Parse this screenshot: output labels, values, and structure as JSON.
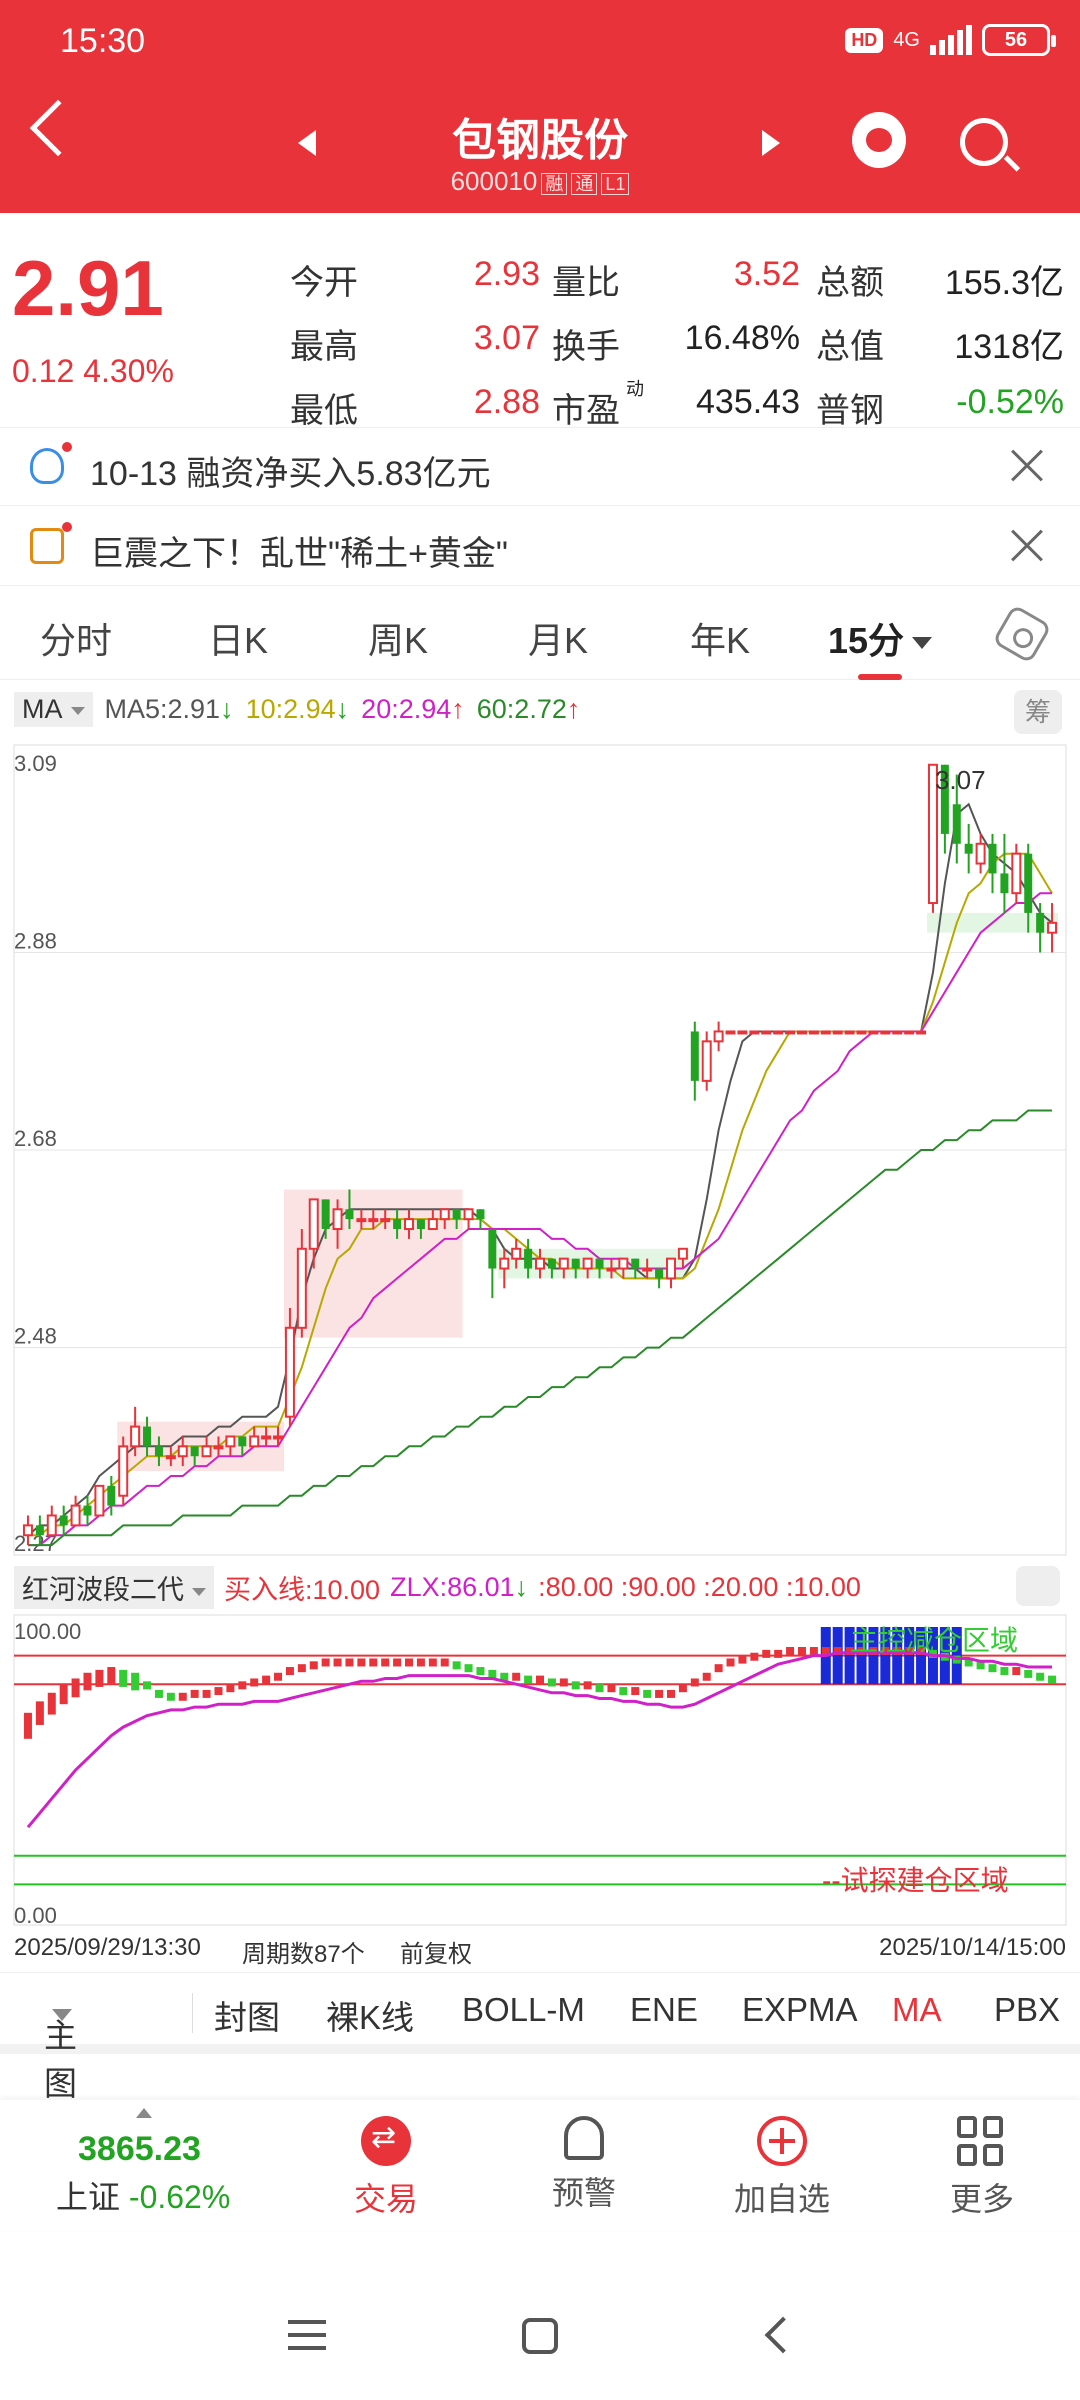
{
  "status_bar": {
    "time": "15:30",
    "hd": "HD",
    "network": "4G",
    "battery": "56"
  },
  "header": {
    "title": "包钢股份",
    "code": "600010",
    "tags": [
      "融",
      "通",
      "L1"
    ]
  },
  "quote": {
    "price": "2.91",
    "change": "0.12",
    "change_pct": "4.30%",
    "fields": [
      {
        "label": "今开",
        "value": "2.93",
        "color": "red"
      },
      {
        "label": "量比",
        "value": "3.52",
        "color": "red"
      },
      {
        "label": "总额",
        "value": "155.3亿",
        "color": "blk"
      },
      {
        "label": "最高",
        "value": "3.07",
        "color": "red"
      },
      {
        "label": "换手",
        "value": "16.48%",
        "color": "blk"
      },
      {
        "label": "总值",
        "value": "1318亿",
        "color": "blk"
      },
      {
        "label": "最低",
        "value": "2.88",
        "color": "red"
      },
      {
        "label": "市盈",
        "value": "435.43",
        "color": "blk",
        "sup": "动"
      },
      {
        "label": "普钢",
        "value": "-0.52%",
        "color": "green"
      }
    ]
  },
  "news": [
    {
      "icon": "bulb-icon",
      "text": "10-13 融资净买入5.83亿元"
    },
    {
      "icon": "document-icon",
      "text": "巨震之下！乱世\"稀土+黄金\""
    }
  ],
  "period_tabs": [
    "分时",
    "日K",
    "周K",
    "月K",
    "年K",
    "15分"
  ],
  "active_period": "15分",
  "ma_legend": {
    "selector": "MA",
    "ma5": "MA5:2.91",
    "ma10": "10:2.94",
    "ma20": "20:2.94",
    "ma60": "60:2.72",
    "chou": "筹"
  },
  "colors": {
    "accent": "#e8333a",
    "up": "#e8333a",
    "down": "#22a322",
    "ma5": "#555555",
    "ma10": "#b8a800",
    "ma20": "#d020c8",
    "ma60": "#2a8a2a"
  },
  "chart_data": [
    {
      "type": "candlestick",
      "title": "",
      "y_ticks": [
        "3.09",
        "2.88",
        "2.68",
        "2.48",
        "2.27"
      ],
      "ylim": [
        2.27,
        3.09
      ],
      "high_label": "3.07",
      "series": [
        {
          "name": "MA5",
          "values": [
            2.29,
            2.3,
            2.3,
            2.31,
            2.32,
            2.33,
            2.35,
            2.36,
            2.37,
            2.38,
            2.38,
            2.38,
            2.38,
            2.39,
            2.39,
            2.39,
            2.4,
            2.4,
            2.41,
            2.41,
            2.41,
            2.42,
            2.47,
            2.53,
            2.57,
            2.6,
            2.61,
            2.62,
            2.62,
            2.62,
            2.62,
            2.62,
            2.62,
            2.62,
            2.62,
            2.62,
            2.62,
            2.62,
            2.61,
            2.6,
            2.58,
            2.57,
            2.57,
            2.57,
            2.56,
            2.56,
            2.56,
            2.56,
            2.56,
            2.56,
            2.56,
            2.56,
            2.55,
            2.55,
            2.55,
            2.55,
            2.57,
            2.63,
            2.7,
            2.75,
            2.79,
            2.8,
            2.8,
            2.8,
            2.8,
            2.8,
            2.8,
            2.8,
            2.8,
            2.8,
            2.8,
            2.8,
            2.8,
            2.8,
            2.8,
            2.8,
            2.86,
            2.95,
            3.02,
            3.03,
            3.0,
            2.98,
            2.97,
            2.96,
            2.94,
            2.92,
            2.91
          ]
        },
        {
          "name": "MA10",
          "values": [
            2.29,
            2.29,
            2.3,
            2.3,
            2.31,
            2.32,
            2.33,
            2.34,
            2.35,
            2.36,
            2.37,
            2.37,
            2.37,
            2.38,
            2.38,
            2.38,
            2.38,
            2.39,
            2.39,
            2.4,
            2.4,
            2.4,
            2.43,
            2.46,
            2.5,
            2.54,
            2.57,
            2.58,
            2.6,
            2.6,
            2.61,
            2.61,
            2.61,
            2.61,
            2.61,
            2.61,
            2.61,
            2.61,
            2.61,
            2.6,
            2.6,
            2.59,
            2.58,
            2.57,
            2.57,
            2.56,
            2.56,
            2.56,
            2.56,
            2.56,
            2.55,
            2.55,
            2.55,
            2.55,
            2.55,
            2.55,
            2.56,
            2.59,
            2.62,
            2.66,
            2.7,
            2.73,
            2.76,
            2.78,
            2.8,
            2.8,
            2.8,
            2.8,
            2.8,
            2.8,
            2.8,
            2.8,
            2.8,
            2.8,
            2.8,
            2.8,
            2.83,
            2.87,
            2.91,
            2.94,
            2.95,
            2.97,
            2.98,
            2.98,
            2.98,
            2.96,
            2.94
          ]
        },
        {
          "name": "MA20",
          "values": [
            2.28,
            2.28,
            2.29,
            2.29,
            2.3,
            2.3,
            2.31,
            2.32,
            2.32,
            2.33,
            2.34,
            2.34,
            2.35,
            2.35,
            2.36,
            2.36,
            2.37,
            2.37,
            2.37,
            2.38,
            2.38,
            2.38,
            2.4,
            2.42,
            2.44,
            2.46,
            2.48,
            2.5,
            2.51,
            2.53,
            2.54,
            2.55,
            2.56,
            2.57,
            2.58,
            2.59,
            2.59,
            2.6,
            2.6,
            2.6,
            2.6,
            2.6,
            2.6,
            2.6,
            2.59,
            2.59,
            2.58,
            2.58,
            2.57,
            2.57,
            2.57,
            2.56,
            2.56,
            2.56,
            2.56,
            2.56,
            2.57,
            2.58,
            2.59,
            2.61,
            2.63,
            2.65,
            2.67,
            2.69,
            2.71,
            2.72,
            2.74,
            2.75,
            2.76,
            2.78,
            2.79,
            2.8,
            2.8,
            2.8,
            2.8,
            2.8,
            2.82,
            2.84,
            2.86,
            2.88,
            2.9,
            2.91,
            2.92,
            2.93,
            2.93,
            2.94,
            2.94
          ]
        },
        {
          "name": "MA60",
          "values": [
            2.28,
            2.28,
            2.28,
            2.29,
            2.29,
            2.29,
            2.29,
            2.29,
            2.3,
            2.3,
            2.3,
            2.3,
            2.3,
            2.31,
            2.31,
            2.31,
            2.31,
            2.31,
            2.32,
            2.32,
            2.32,
            2.32,
            2.33,
            2.33,
            2.34,
            2.34,
            2.35,
            2.35,
            2.36,
            2.36,
            2.37,
            2.37,
            2.38,
            2.38,
            2.39,
            2.39,
            2.4,
            2.4,
            2.41,
            2.41,
            2.42,
            2.42,
            2.43,
            2.43,
            2.44,
            2.44,
            2.45,
            2.45,
            2.46,
            2.46,
            2.47,
            2.47,
            2.48,
            2.48,
            2.49,
            2.49,
            2.5,
            2.51,
            2.52,
            2.53,
            2.54,
            2.55,
            2.56,
            2.57,
            2.58,
            2.59,
            2.6,
            2.61,
            2.62,
            2.63,
            2.64,
            2.65,
            2.66,
            2.66,
            2.67,
            2.68,
            2.68,
            2.69,
            2.69,
            2.7,
            2.7,
            2.71,
            2.71,
            2.71,
            2.72,
            2.72,
            2.72
          ]
        }
      ],
      "candles": [
        [
          2.29,
          2.3,
          2.28,
          2.31
        ],
        [
          2.3,
          2.29,
          2.28,
          2.31
        ],
        [
          2.29,
          2.31,
          2.29,
          2.32
        ],
        [
          2.31,
          2.3,
          2.29,
          2.32
        ],
        [
          2.3,
          2.32,
          2.3,
          2.33
        ],
        [
          2.32,
          2.31,
          2.3,
          2.33
        ],
        [
          2.31,
          2.34,
          2.31,
          2.34
        ],
        [
          2.34,
          2.32,
          2.31,
          2.35
        ],
        [
          2.33,
          2.38,
          2.32,
          2.39
        ],
        [
          2.38,
          2.4,
          2.37,
          2.42
        ],
        [
          2.4,
          2.38,
          2.37,
          2.41
        ],
        [
          2.38,
          2.37,
          2.36,
          2.39
        ],
        [
          2.37,
          2.37,
          2.36,
          2.38
        ],
        [
          2.37,
          2.38,
          2.36,
          2.39
        ],
        [
          2.38,
          2.37,
          2.36,
          2.38
        ],
        [
          2.37,
          2.38,
          2.37,
          2.39
        ],
        [
          2.38,
          2.38,
          2.37,
          2.39
        ],
        [
          2.38,
          2.39,
          2.37,
          2.39
        ],
        [
          2.39,
          2.38,
          2.37,
          2.39
        ],
        [
          2.38,
          2.39,
          2.38,
          2.4
        ],
        [
          2.39,
          2.39,
          2.38,
          2.4
        ],
        [
          2.39,
          2.39,
          2.38,
          2.4
        ],
        [
          2.41,
          2.5,
          2.4,
          2.52
        ],
        [
          2.5,
          2.58,
          2.49,
          2.6
        ],
        [
          2.58,
          2.63,
          2.56,
          2.63
        ],
        [
          2.63,
          2.6,
          2.59,
          2.63
        ],
        [
          2.6,
          2.62,
          2.58,
          2.63
        ],
        [
          2.62,
          2.61,
          2.6,
          2.64
        ],
        [
          2.61,
          2.61,
          2.6,
          2.62
        ],
        [
          2.61,
          2.61,
          2.6,
          2.62
        ],
        [
          2.61,
          2.61,
          2.6,
          2.62
        ],
        [
          2.61,
          2.6,
          2.59,
          2.62
        ],
        [
          2.6,
          2.61,
          2.59,
          2.62
        ],
        [
          2.61,
          2.6,
          2.59,
          2.61
        ],
        [
          2.6,
          2.61,
          2.6,
          2.62
        ],
        [
          2.61,
          2.62,
          2.6,
          2.62
        ],
        [
          2.62,
          2.61,
          2.6,
          2.62
        ],
        [
          2.61,
          2.62,
          2.6,
          2.62
        ],
        [
          2.62,
          2.61,
          2.6,
          2.62
        ],
        [
          2.6,
          2.56,
          2.53,
          2.6
        ],
        [
          2.56,
          2.57,
          2.54,
          2.58
        ],
        [
          2.57,
          2.58,
          2.56,
          2.59
        ],
        [
          2.58,
          2.56,
          2.55,
          2.59
        ],
        [
          2.56,
          2.57,
          2.55,
          2.58
        ],
        [
          2.57,
          2.56,
          2.55,
          2.57
        ],
        [
          2.56,
          2.57,
          2.55,
          2.57
        ],
        [
          2.57,
          2.56,
          2.55,
          2.57
        ],
        [
          2.56,
          2.57,
          2.55,
          2.57
        ],
        [
          2.57,
          2.56,
          2.55,
          2.57
        ],
        [
          2.56,
          2.56,
          2.55,
          2.57
        ],
        [
          2.56,
          2.57,
          2.55,
          2.57
        ],
        [
          2.57,
          2.56,
          2.55,
          2.57
        ],
        [
          2.56,
          2.56,
          2.55,
          2.57
        ],
        [
          2.56,
          2.55,
          2.54,
          2.56
        ],
        [
          2.55,
          2.57,
          2.54,
          2.57
        ],
        [
          2.57,
          2.58,
          2.56,
          2.58
        ],
        [
          2.8,
          2.75,
          2.73,
          2.81
        ],
        [
          2.75,
          2.79,
          2.74,
          2.8
        ],
        [
          2.79,
          2.8,
          2.78,
          2.81
        ],
        [
          2.8,
          2.8,
          2.8,
          2.8
        ],
        [
          2.8,
          2.8,
          2.8,
          2.8
        ],
        [
          2.8,
          2.8,
          2.8,
          2.8
        ],
        [
          2.8,
          2.8,
          2.8,
          2.8
        ],
        [
          2.8,
          2.8,
          2.8,
          2.8
        ],
        [
          2.8,
          2.8,
          2.8,
          2.8
        ],
        [
          2.8,
          2.8,
          2.8,
          2.8
        ],
        [
          2.8,
          2.8,
          2.8,
          2.8
        ],
        [
          2.8,
          2.8,
          2.8,
          2.8
        ],
        [
          2.8,
          2.8,
          2.8,
          2.8
        ],
        [
          2.8,
          2.8,
          2.8,
          2.8
        ],
        [
          2.8,
          2.8,
          2.8,
          2.8
        ],
        [
          2.8,
          2.8,
          2.8,
          2.8
        ],
        [
          2.8,
          2.8,
          2.8,
          2.8
        ],
        [
          2.8,
          2.8,
          2.8,
          2.8
        ],
        [
          2.8,
          2.8,
          2.8,
          2.8
        ],
        [
          2.8,
          2.8,
          2.8,
          2.8
        ],
        [
          2.93,
          3.07,
          2.92,
          3.07
        ],
        [
          3.07,
          3.0,
          2.98,
          3.07
        ],
        [
          3.03,
          2.99,
          2.97,
          3.06
        ],
        [
          2.99,
          2.98,
          2.96,
          3.01
        ],
        [
          2.97,
          2.99,
          2.96,
          3.0
        ],
        [
          2.99,
          2.96,
          2.94,
          3.0
        ],
        [
          2.96,
          2.94,
          2.92,
          3.0
        ],
        [
          2.94,
          2.98,
          2.93,
          2.99
        ],
        [
          2.98,
          2.92,
          2.9,
          2.99
        ],
        [
          2.92,
          2.9,
          2.88,
          2.93
        ],
        [
          2.9,
          2.91,
          2.88,
          2.93
        ]
      ]
    },
    {
      "type": "line",
      "title": "红河波段二代",
      "y_ticks": [
        "100.00",
        "0.00"
      ],
      "ylim": [
        0,
        100
      ],
      "legend": {
        "buy": "买入线:10.00",
        "zlx": "ZLX:86.01",
        "levels": ":80.00 :90.00 :20.00 :10.00"
      },
      "reference_lines": [
        {
          "value": 90,
          "color": "#e8333a"
        },
        {
          "value": 80,
          "color": "#e8333a"
        },
        {
          "value": 20,
          "color": "#22c322"
        },
        {
          "value": 10,
          "color": "#22c322"
        }
      ],
      "zone_labels": {
        "top": "主控减仓区域",
        "bottom": "--试探建仓区域"
      },
      "series": [
        {
          "name": "ZLX",
          "values": [
            30,
            35,
            40,
            45,
            50,
            54,
            58,
            62,
            65,
            67,
            69,
            70,
            71,
            71,
            72,
            72,
            73,
            73,
            73,
            74,
            74,
            74,
            75,
            76,
            77,
            78,
            79,
            80,
            81,
            81,
            82,
            82,
            83,
            83,
            83,
            83,
            83,
            83,
            82,
            82,
            81,
            80,
            79,
            78,
            77,
            77,
            76,
            76,
            75,
            75,
            74,
            74,
            73,
            73,
            72,
            72,
            73,
            75,
            77,
            79,
            81,
            83,
            85,
            87,
            88,
            89,
            90,
            90,
            91,
            91,
            91,
            91,
            91,
            91,
            91,
            91,
            90,
            90,
            89,
            89,
            88,
            88,
            87,
            87,
            86,
            86,
            86
          ]
        },
        {
          "name": "SIGNAL",
          "values": [
            70,
            74,
            77,
            80,
            82,
            84,
            85,
            86,
            85,
            84,
            81,
            78,
            77,
            77,
            78,
            78,
            79,
            80,
            81,
            82,
            83,
            84,
            86,
            87,
            88,
            89,
            89,
            89,
            89,
            89,
            89,
            89,
            89,
            89,
            89,
            89,
            88,
            87,
            86,
            85,
            84,
            84,
            83,
            83,
            82,
            82,
            81,
            81,
            80,
            80,
            79,
            79,
            78,
            78,
            78,
            80,
            82,
            84,
            87,
            89,
            90,
            91,
            92,
            92,
            93,
            93,
            93,
            93,
            93,
            93,
            93,
            93,
            93,
            93,
            93,
            93,
            92,
            91,
            90,
            89,
            88,
            87,
            86,
            86,
            85,
            84,
            83
          ]
        }
      ]
    }
  ],
  "indicator": {
    "selector": "红河波段二代"
  },
  "dates": {
    "start": "2025/09/29/13:30",
    "count": "周期数87个",
    "adjust": "前复权",
    "end": "2025/10/14/15:00"
  },
  "indicator_bar": [
    "主图",
    "封图",
    "裸K线",
    "BOLL-M",
    "ENE",
    "EXPMA",
    "MA",
    "PBX"
  ],
  "indicator_bar_active": "MA",
  "bottom_nav": {
    "index_value": "3865.23",
    "index_name": "上证",
    "index_change": "-0.62%",
    "items": [
      "交易",
      "预警",
      "加自选",
      "更多"
    ]
  }
}
